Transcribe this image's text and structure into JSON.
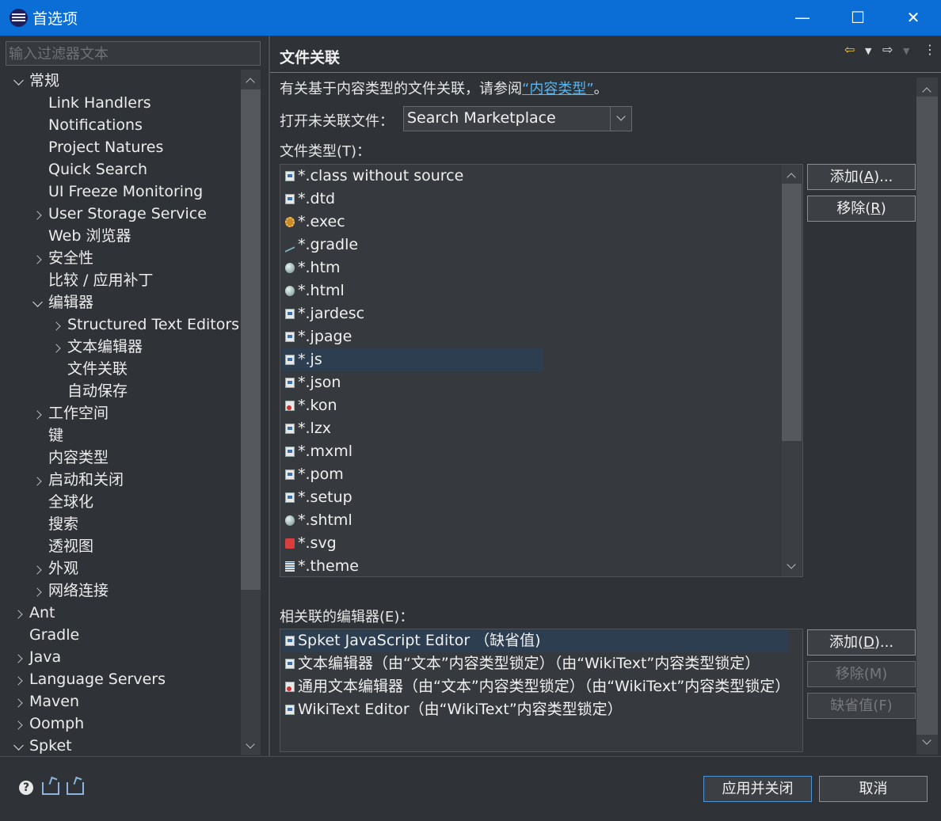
{
  "window": {
    "title": "首选项",
    "minimize": "—",
    "maximize": "☐",
    "close": "✕"
  },
  "filter": {
    "placeholder": "输入过滤器文本"
  },
  "tree": [
    {
      "label": "常规",
      "level": 0,
      "twisty": "down"
    },
    {
      "label": "Link Handlers",
      "level": 1,
      "twisty": "none"
    },
    {
      "label": "Notifications",
      "level": 1,
      "twisty": "none"
    },
    {
      "label": "Project Natures",
      "level": 1,
      "twisty": "none"
    },
    {
      "label": "Quick Search",
      "level": 1,
      "twisty": "none"
    },
    {
      "label": "UI Freeze Monitoring",
      "level": 1,
      "twisty": "none"
    },
    {
      "label": "User Storage Service",
      "level": 1,
      "twisty": "right"
    },
    {
      "label": "Web 浏览器",
      "level": 1,
      "twisty": "none"
    },
    {
      "label": "安全性",
      "level": 1,
      "twisty": "right"
    },
    {
      "label": "比较 / 应用补丁",
      "level": 1,
      "twisty": "none"
    },
    {
      "label": "编辑器",
      "level": 1,
      "twisty": "down"
    },
    {
      "label": "Structured Text Editors",
      "level": 2,
      "twisty": "right"
    },
    {
      "label": "文本编辑器",
      "level": 2,
      "twisty": "right"
    },
    {
      "label": "文件关联",
      "level": 2,
      "twisty": "none"
    },
    {
      "label": "自动保存",
      "level": 2,
      "twisty": "none"
    },
    {
      "label": "工作空间",
      "level": 1,
      "twisty": "right"
    },
    {
      "label": "键",
      "level": 1,
      "twisty": "none"
    },
    {
      "label": "内容类型",
      "level": 1,
      "twisty": "none"
    },
    {
      "label": "启动和关闭",
      "level": 1,
      "twisty": "right"
    },
    {
      "label": "全球化",
      "level": 1,
      "twisty": "none"
    },
    {
      "label": "搜索",
      "level": 1,
      "twisty": "none"
    },
    {
      "label": "透视图",
      "level": 1,
      "twisty": "none"
    },
    {
      "label": "外观",
      "level": 1,
      "twisty": "right"
    },
    {
      "label": "网络连接",
      "level": 1,
      "twisty": "right"
    },
    {
      "label": "Ant",
      "level": 0,
      "twisty": "right"
    },
    {
      "label": "Gradle",
      "level": 0,
      "twisty": "none"
    },
    {
      "label": "Java",
      "level": 0,
      "twisty": "right"
    },
    {
      "label": "Language Servers",
      "level": 0,
      "twisty": "right"
    },
    {
      "label": "Maven",
      "level": 0,
      "twisty": "right"
    },
    {
      "label": "Oomph",
      "level": 0,
      "twisty": "right"
    },
    {
      "label": "Spket",
      "level": 0,
      "twisty": "down"
    }
  ],
  "page": {
    "title": "文件关联",
    "info_prefix": "有关基于内容类型的文件关联，请参阅",
    "info_link": "“内容类型”",
    "info_suffix": "。",
    "open_unassoc_label": "打开未关联文件：",
    "open_unassoc_value": "Search Marketplace",
    "file_types_label": "文件类型(T)：",
    "editors_label": "相关联的编辑器(E)："
  },
  "file_types": [
    {
      "name": "*.class without source",
      "icon": "doc"
    },
    {
      "name": "*.dtd",
      "icon": "doc"
    },
    {
      "name": "*.exec",
      "icon": "gear"
    },
    {
      "name": "*.gradle",
      "icon": "ant"
    },
    {
      "name": "*.htm",
      "icon": "globe"
    },
    {
      "name": "*.html",
      "icon": "globe"
    },
    {
      "name": "*.jardesc",
      "icon": "doc"
    },
    {
      "name": "*.jpage",
      "icon": "doc"
    },
    {
      "name": "*.js",
      "icon": "doc",
      "selected": true
    },
    {
      "name": "*.json",
      "icon": "doc"
    },
    {
      "name": "*.kon",
      "icon": "redx"
    },
    {
      "name": "*.lzx",
      "icon": "doc"
    },
    {
      "name": "*.mxml",
      "icon": "doc"
    },
    {
      "name": "*.pom",
      "icon": "doc"
    },
    {
      "name": "*.setup",
      "icon": "doc"
    },
    {
      "name": "*.shtml",
      "icon": "globe"
    },
    {
      "name": "*.svg",
      "icon": "svg"
    },
    {
      "name": "*.theme",
      "icon": "grid"
    }
  ],
  "editors": [
    {
      "name": "Spket JavaScript Editor （缺省值)",
      "icon": "doc",
      "selected": true
    },
    {
      "name": "文本编辑器（由“文本”内容类型锁定）（由“WikiText”内容类型锁定）",
      "icon": "doc"
    },
    {
      "name": "通用文本编辑器（由“文本”内容类型锁定）（由“WikiText”内容类型锁定）",
      "icon": "redx"
    },
    {
      "name": "WikiText Editor（由“WikiText”内容类型锁定）",
      "icon": "doc"
    }
  ],
  "buttons": {
    "add_type_pre": "添加(",
    "add_type_key": "A",
    "add_type_post": ")...",
    "remove_type_pre": "移除(",
    "remove_type_key": "R",
    "remove_type_post": ")",
    "add_editor_pre": "添加(",
    "add_editor_key": "D",
    "add_editor_post": ")...",
    "remove_editor": "移除(M)",
    "default_editor": "缺省值(F)",
    "apply_close": "应用并关闭",
    "cancel": "取消"
  },
  "colors": {
    "titlebar": "#0a6ed6",
    "background": "#2f3337",
    "link": "#58b4f0",
    "selection": "#2c3e50"
  }
}
